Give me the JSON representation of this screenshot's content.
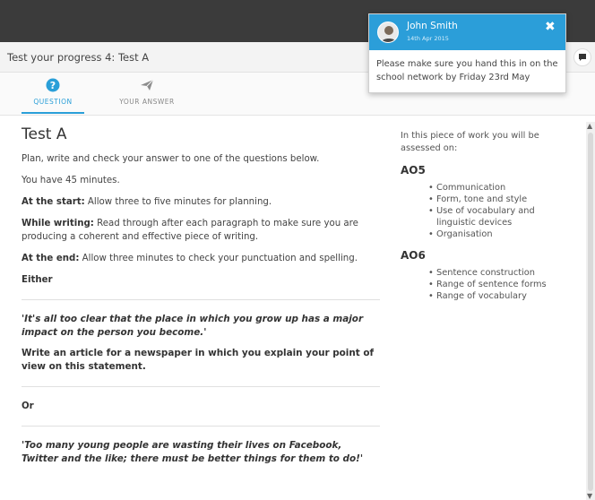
{
  "page": {
    "title": "Test your progress 4: Test A"
  },
  "tabs": {
    "question_label": "QUESTION",
    "answer_label": "YOUR ANSWER",
    "active": "QUESTION"
  },
  "notification": {
    "name": "John Smith",
    "date": "14th Apr 2015",
    "message": "Please make sure you hand this in on the school network by Friday 23rd May"
  },
  "content": {
    "heading": "Test A",
    "instruction": "Plan, write and check your answer to one of the questions below.",
    "time": "You have 45 minutes.",
    "start_label": "At the start:",
    "start_text": " Allow three to five minutes for planning.",
    "writing_label": "While writing:",
    "writing_text": " Read through after each paragraph to make sure you are producing a coherent and effective piece of writing.",
    "end_label": "At the end:",
    "end_text": " Allow three minutes to check your punctuation and spelling.",
    "either": "Either",
    "quote1": "'It's all too clear that the place in which you grow up has a major impact on the person you become.'",
    "task1": "Write an article for a newspaper in which you explain your point of view on this statement.",
    "or": "Or",
    "quote2": "'Too many young people are wasting their lives on Facebook, Twitter and the like; there must be better things for them to do!'"
  },
  "assessment": {
    "intro": "In this piece of work you will be assessed on:",
    "ao5_title": "AO5",
    "ao5_items": [
      "Communication",
      "Form, tone and style",
      "Use of vocabulary and linguistic devices",
      "Organisation"
    ],
    "ao6_title": "AO6",
    "ao6_items": [
      "Sentence construction",
      "Range of sentence forms",
      "Range of vocabulary"
    ]
  },
  "colors": {
    "accent": "#2a9fd8",
    "topbar": "#3b3b3b",
    "notification_header": "#2b9ed9"
  },
  "icons": {
    "question_tab": "question-circle-icon",
    "answer_tab": "paper-plane-icon",
    "chat": "chat-bubble-icon",
    "close": "close-icon",
    "avatar": "avatar"
  }
}
